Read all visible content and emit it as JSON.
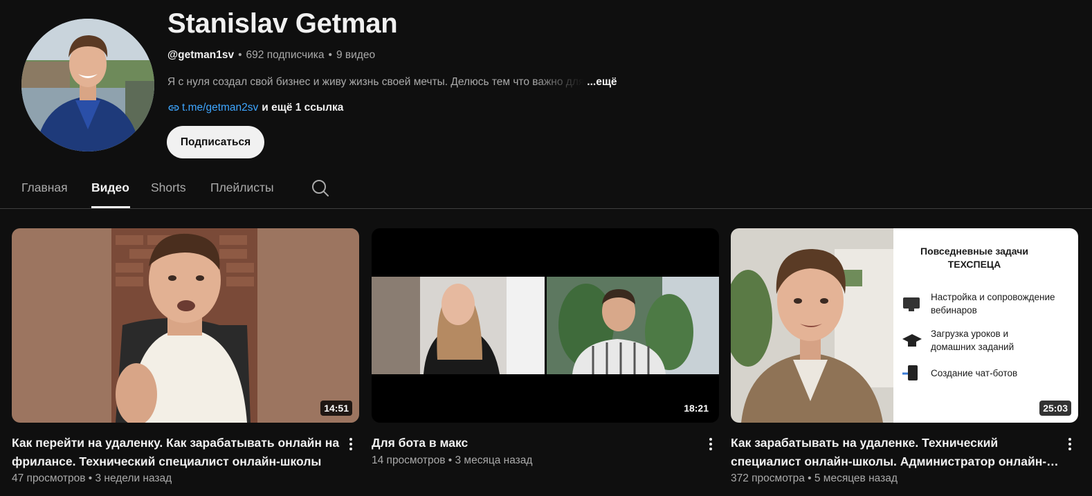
{
  "channel": {
    "title": "Stanislav Getman",
    "handle": "@getman1sv",
    "subscribers": "692 подписчика",
    "videos_count": "9 видео",
    "description": "Я с нуля создал свой бизнес и живу жизнь своей мечты. Делюсь тем что важно для",
    "description_more": "...ещё",
    "link": "t.me/getman2sv",
    "more_links": "и ещё 1 ссылка",
    "subscribe_label": "Подписаться"
  },
  "tabs": [
    {
      "label": "Главная",
      "active": false
    },
    {
      "label": "Видео",
      "active": true
    },
    {
      "label": "Shorts",
      "active": false
    },
    {
      "label": "Плейлисты",
      "active": false
    }
  ],
  "videos": [
    {
      "title": "Как перейти на удаленку. Как зарабатывать онлайн на фрилансе. Технический специалист онлайн-школы",
      "duration": "14:51",
      "views": "47 просмотров",
      "age": "3 недели назад"
    },
    {
      "title": "Для бота в макс",
      "duration": "18:21",
      "views": "14 просмотров",
      "age": "3 месяца назад"
    },
    {
      "title": "Как зарабатывать на удаленке. Технический специалист онлайн-школы. Администратор онлайн-школы",
      "duration": "25:03",
      "views": "372 просмотра",
      "age": "5 месяцев назад",
      "slide": {
        "heading_1": "Повседневные задачи",
        "heading_2": "ТЕХСПЕЦА",
        "item_1a": "Настройка и сопровождение",
        "item_1b": "вебинаров",
        "item_2a": "Загрузка уроков и",
        "item_2b": "домашних заданий",
        "item_3": "Создание чат-ботов"
      }
    }
  ],
  "colors": {
    "background": "#0f0f0f",
    "text_primary": "#f1f1f1",
    "text_secondary": "#aaaaaa",
    "link": "#3ea6ff"
  },
  "icons": [
    "link-icon",
    "search-icon",
    "more-vert-icon"
  ]
}
